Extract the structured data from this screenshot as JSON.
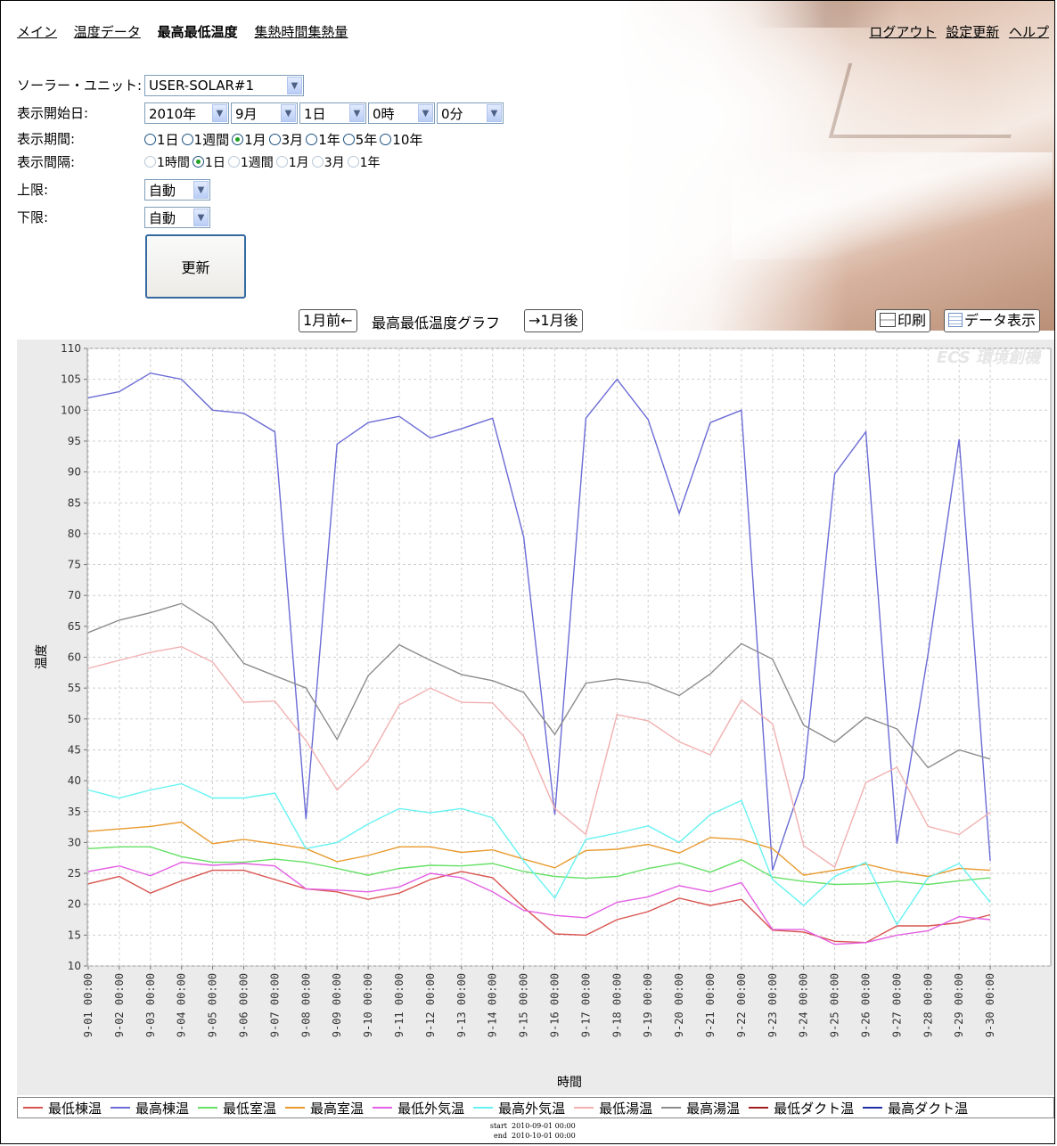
{
  "nav": {
    "items": [
      "メイン",
      "温度データ",
      "最高最低温度",
      "集熱時間集熱量"
    ],
    "current": "最高最低温度",
    "right_links": [
      "ログアウト",
      "設定更新",
      "ヘルプ"
    ]
  },
  "form": {
    "unit_label": "ソーラー・ユニット:",
    "unit_value": "USER-SOLAR#1",
    "start_label": "表示開始日:",
    "start_year": "2010年",
    "start_month": "9月",
    "start_day": "1日",
    "start_hour": "0時",
    "start_minute": "0分",
    "period_label": "表示期間:",
    "period_options": [
      "1日",
      "1週間",
      "1月",
      "3月",
      "1年",
      "5年",
      "10年"
    ],
    "period_selected": "1月",
    "interval_label": "表示間隔:",
    "interval_options": [
      "1時間",
      "1日",
      "1週間",
      "1月",
      "3月",
      "1年"
    ],
    "interval_selected": "1日",
    "upper_label": "上限:",
    "upper_value": "自動",
    "lower_label": "下限:",
    "lower_value": "自動",
    "update_label": "更新"
  },
  "graph_bar": {
    "prev_label": "1月前←",
    "title": "最高最低温度グラフ",
    "next_label": "→1月後",
    "print_label": "印刷",
    "data_label": "データ表示"
  },
  "footer": {
    "start_key": "start",
    "start_value": "2010-09-01 00:00",
    "end_key": "end",
    "end_value": "2010-10-01 00:00"
  },
  "chart_data": {
    "type": "line",
    "xlabel": "時間",
    "ylabel": "温度",
    "ylim": [
      10,
      110
    ],
    "yticks": [
      10,
      15,
      20,
      25,
      30,
      35,
      40,
      45,
      50,
      55,
      60,
      65,
      70,
      75,
      80,
      85,
      90,
      95,
      100,
      105,
      110
    ],
    "grid": true,
    "legend": "bottom",
    "watermark": "ECS 環境創機",
    "categories": [
      "9-01 00:00",
      "9-02 00:00",
      "9-03 00:00",
      "9-04 00:00",
      "9-05 00:00",
      "9-06 00:00",
      "9-07 00:00",
      "9-08 00:00",
      "9-09 00:00",
      "9-10 00:00",
      "9-11 00:00",
      "9-12 00:00",
      "9-13 00:00",
      "9-14 00:00",
      "9-15 00:00",
      "9-16 00:00",
      "9-17 00:00",
      "9-18 00:00",
      "9-19 00:00",
      "9-20 00:00",
      "9-21 00:00",
      "9-22 00:00",
      "9-23 00:00",
      "9-24 00:00",
      "9-25 00:00",
      "9-26 00:00",
      "9-27 00:00",
      "9-28 00:00",
      "9-29 00:00",
      "9-30 00:00"
    ],
    "series": [
      {
        "name": "最低棟温",
        "color": "#d9534f",
        "values": [
          23.3,
          24.5,
          21.8,
          23.8,
          25.5,
          25.5,
          24,
          22.5,
          22,
          20.8,
          21.8,
          24,
          25.3,
          24.3,
          19.5,
          15.2,
          15,
          17.5,
          18.8,
          21,
          19.8,
          20.8,
          15.8,
          15.5,
          14,
          13.8,
          16.5,
          16.5,
          17,
          18.3
        ]
      },
      {
        "name": "最高棟温",
        "color": "#6b6bd6",
        "values": [
          102,
          103,
          106,
          105,
          100,
          99.5,
          96.5,
          33.8,
          94.5,
          98,
          99,
          95.5,
          97,
          98.7,
          79.5,
          34.5,
          98.7,
          105,
          98.5,
          83.3,
          98,
          100,
          25.5,
          40.5,
          89.7,
          96.5,
          29.8,
          60.5,
          95.3,
          27
        ]
      },
      {
        "name": "最低室温",
        "color": "#66e066",
        "values": [
          29,
          29.3,
          29.3,
          27.7,
          26.8,
          26.8,
          27.3,
          26.8,
          25.8,
          24.7,
          25.8,
          26.3,
          26.2,
          26.6,
          25.3,
          24.5,
          24.2,
          24.5,
          25.8,
          26.7,
          25.2,
          27.2,
          24.4,
          23.7,
          23.2,
          23.3,
          23.7,
          23.2,
          23.8,
          24.3
        ]
      },
      {
        "name": "最高室温",
        "color": "#e89a2e",
        "values": [
          31.8,
          32.2,
          32.6,
          33.3,
          29.8,
          30.5,
          29.8,
          29,
          26.9,
          27.9,
          29.3,
          29.3,
          28.4,
          28.8,
          27.3,
          25.9,
          28.7,
          28.9,
          29.7,
          28.3,
          30.8,
          30.5,
          29,
          24.7,
          25.5,
          26.5,
          25.3,
          24.5,
          25.8,
          25.5
        ]
      },
      {
        "name": "最低外気温",
        "color": "#e35fe3",
        "values": [
          25.3,
          26.2,
          24.6,
          26.8,
          26.3,
          26.6,
          26.2,
          22.5,
          22.3,
          22.0,
          22.8,
          25.0,
          24.3,
          22.0,
          19.0,
          18.2,
          17.8,
          20.3,
          21.2,
          23.0,
          22.0,
          23.5,
          15.9,
          15.9,
          13.5,
          13.8,
          15.0,
          15.7,
          18.0,
          17.5
        ]
      },
      {
        "name": "最高外気温",
        "color": "#66f2f2",
        "values": [
          38.5,
          37.2,
          38.5,
          39.5,
          37.2,
          37.2,
          38,
          29,
          30,
          33,
          35.5,
          34.8,
          35.5,
          34,
          27,
          21,
          30.5,
          31.5,
          32.7,
          30,
          34.5,
          36.8,
          24,
          19.8,
          24.5,
          26.8,
          16.7,
          24.3,
          26.6,
          20.3
        ]
      },
      {
        "name": "最低湯温",
        "color": "#f2b0b0",
        "values": [
          58.2,
          59.5,
          60.8,
          61.7,
          59.2,
          52.7,
          52.9,
          46.5,
          38.5,
          43.3,
          52.3,
          55,
          52.7,
          52.6,
          47.2,
          35.5,
          31.3,
          50.7,
          49.7,
          46.3,
          44.2,
          53.1,
          49.2,
          29.5,
          26,
          39.7,
          42.2,
          32.6,
          31.3,
          34.9
        ]
      },
      {
        "name": "最高湯温",
        "color": "#8c8c8c",
        "values": [
          64,
          66,
          67.2,
          68.7,
          65.5,
          59,
          57,
          55,
          46.7,
          57,
          62,
          59.5,
          57.2,
          56.2,
          54.3,
          47.5,
          55.8,
          56.5,
          55.8,
          53.8,
          57.3,
          62.2,
          59.7,
          49,
          46.2,
          50.3,
          48.4,
          42.1,
          45,
          43.5
        ]
      },
      {
        "name": "最低ダクト温",
        "color": "#a11c1c",
        "values": []
      },
      {
        "name": "最高ダクト温",
        "color": "#1f2fa8",
        "values": []
      }
    ]
  }
}
